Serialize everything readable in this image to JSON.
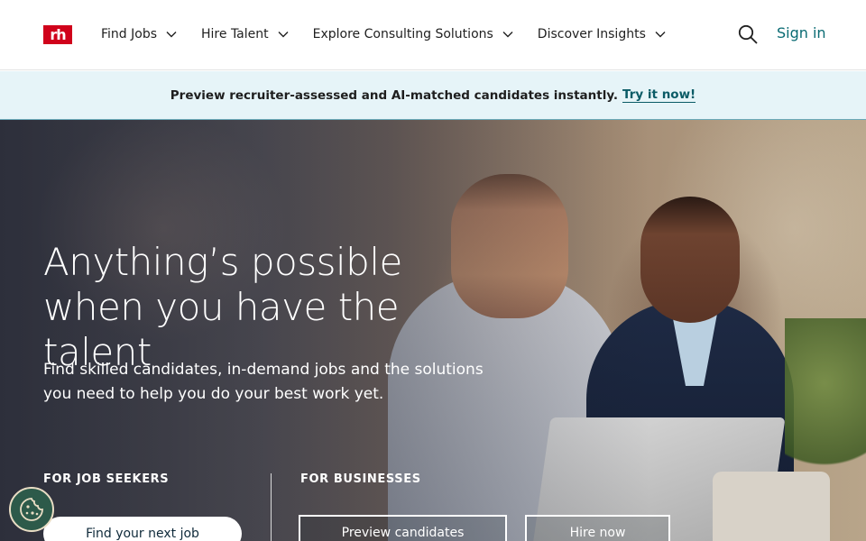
{
  "brand": {
    "logo_text": "rh",
    "logo_color": "#d0021b"
  },
  "header": {
    "nav": [
      {
        "label": "Find Jobs"
      },
      {
        "label": "Hire Talent"
      },
      {
        "label": "Explore Consulting Solutions"
      },
      {
        "label": "Discover Insights"
      }
    ],
    "search_icon": "search-icon",
    "sign_in": "Sign in"
  },
  "banner": {
    "text": "Preview recruiter-assessed and AI-matched candidates instantly.",
    "link": "Try it now!"
  },
  "hero": {
    "title": "Anything’s possible when you have the talent",
    "subtitle": "Find skilled candidates, in-demand jobs and the solutions you need to help you do your best work yet.",
    "seekers_label": "FOR JOB SEEKERS",
    "business_label": "FOR BUSINESSES",
    "find_job_button": "Find your next job",
    "preview_button": "Preview candidates",
    "hire_button": "Hire now"
  },
  "colors": {
    "accent": "#0a6b73",
    "banner_bg": "#e6f4f8",
    "cookie_button": "#2d5a4a"
  },
  "cookie_icon": "cookie-icon"
}
